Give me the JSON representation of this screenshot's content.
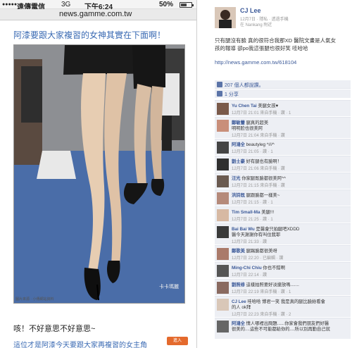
{
  "phone": {
    "status": {
      "carrier": "遠傳電信",
      "network": "3G",
      "time": "下午6:24",
      "battery_text": "50%",
      "battery_level": 0.5
    },
    "url": "news.gamme.com.tw",
    "headline": "阿漆要跟大家複習的女神其實在下面啊！",
    "photo_watermark": "卡卡瑪麗",
    "caption": "咳！不好意思不好意思~",
    "caption_cut": "這位才是阿漆今天要跟大家再複習的女主角",
    "float_button": "進入"
  },
  "fb": {
    "poster": "CJ Lee",
    "meta": "12月7日 · 隱私 · 透過手機",
    "location": "在 Nankang 附近",
    "body_line1": "只有腿沒有臉 真的很符合我那XD 醫院文畫是人氣女",
    "body_line2": "孩的報導 卻po我這張腿也很好笑 哇哈哈",
    "link": "http://news.gamme.com.tw/618104",
    "likes": "207 個人都說讚。",
    "shares": "1 分享",
    "comments": [
      {
        "name": "Yu Chen Tai",
        "text": "美腿女孩♥",
        "meta": "12月7日 21:01 來自手機 · 讚 · 1"
      },
      {
        "name": "鄭敏蕾",
        "text": "腿真的超美",
        "text2": "明明脸也很美阿",
        "meta": "12月7日 21:04 來自手機 · 讚"
      },
      {
        "name": "阿鴻全",
        "text": "beautyleg ^///^",
        "meta": "12月7日 21:05 · 讚 · 1"
      },
      {
        "name": "劉士豪",
        "text": "好有腿也有臉啊！",
        "meta": "12月7日 21:06 來自手機 · 讚"
      },
      {
        "name": "汪光",
        "text": "你家腿既臉都很美阿^^",
        "meta": "12月7日 21:15 來自手機 · 讚"
      },
      {
        "name": "洪詩既",
        "text": "腿跟臉都一樣美~",
        "meta": "12月7日 21:15 · 讚 · 1"
      },
      {
        "name": "Tim Small-Ma",
        "text": "美腿!!!",
        "meta": "12月7日 21:25 · 讚 · 1"
      },
      {
        "name": "Bai Bai Wu",
        "text": "是醫會只拍腿吧XDDD",
        "text2": "醫今天謝謝你有叫住我耶",
        "meta": "12月7日 21:33 · 讚"
      },
      {
        "name": "鄭歌美",
        "text": "腿踢臉都很美呀",
        "meta": "12月7日 22:20 · 已編輯 · 讚"
      },
      {
        "name": "Ming-Chi Chiu",
        "text": "你也不錯啊",
        "meta": "12月7日 22:14 · 讚"
      },
      {
        "name": "劉照修",
        "text": "這樣拍照要好淡捷放嗎.......",
        "meta": "12月7日 22:19 來自手機 · 讚 · 1"
      },
      {
        "name": "CJ Lee",
        "text": "哇哈哈 博君一笑 我是真的腿比臉紛看會",
        "text2": "的人 ok拜",
        "meta": "12月7日 22:23 來自手機 · 讚 · 2"
      },
      {
        "name": "阿鴻全",
        "text": "情人哪裡出問題......你家會我們朋友們好醫",
        "text2": "很美的....這些不可能都給你的....所以別再勤自己就",
        "meta": ""
      }
    ]
  }
}
